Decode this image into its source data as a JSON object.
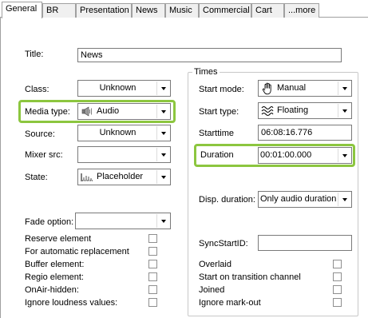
{
  "tabs": [
    "General",
    "BR",
    "Presentation",
    "News",
    "Music",
    "Commercial",
    "Cart",
    "...more"
  ],
  "fields": {
    "title_label": "Title:",
    "title_value": "News",
    "class_label": "Class:",
    "class_value": "Unknown",
    "media_type_label": "Media type:",
    "media_type_value": "Audio",
    "source_label": "Source:",
    "source_value": "Unknown",
    "mixer_src_label": "Mixer src:",
    "mixer_src_value": "",
    "state_label": "State:",
    "state_value": "Placeholder",
    "fade_option_label": "Fade option:",
    "fade_option_value": ""
  },
  "left_checkboxes": [
    "Reserve element",
    "For automatic replacement",
    "Buffer element:",
    "Regio element:",
    "OnAir-hidden:",
    "Ignore loudness values:"
  ],
  "times": {
    "group_title": "Times",
    "start_mode_label": "Start mode:",
    "start_mode_value": "Manual",
    "start_type_label": "Start type:",
    "start_type_value": "Floating",
    "starttime_label": "Starttime",
    "starttime_value": "06:08:16.776",
    "duration_label": "Duration",
    "duration_value": "00:01:00.000",
    "disp_duration_label": "Disp. duration:",
    "disp_duration_value": "Only audio duration",
    "sync_start_label": "SyncStartID:",
    "sync_start_value": ""
  },
  "right_checkboxes": [
    "Overlaid",
    "Start on transition channel",
    "Joined",
    "Ignore mark-out"
  ],
  "colors": {
    "highlight": "#8cc63f"
  }
}
